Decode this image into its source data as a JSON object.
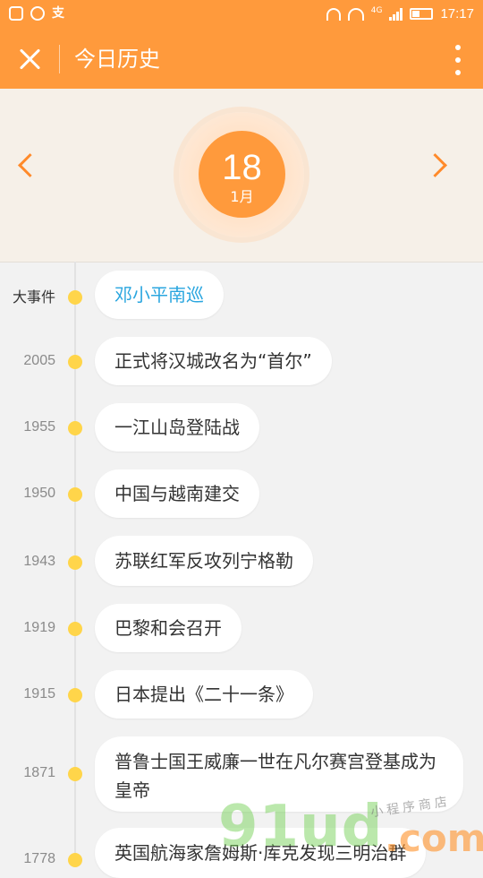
{
  "status_bar": {
    "time": "17:17",
    "network": "4G"
  },
  "app_bar": {
    "title": "今日历史"
  },
  "date": {
    "day": "18",
    "month": "1月"
  },
  "timeline": {
    "items": [
      {
        "year": "大事件",
        "event": "邓小平南巡"
      },
      {
        "year": "2005",
        "event": "正式将汉城改名为“首尔”"
      },
      {
        "year": "1955",
        "event": "一江山岛登陆战"
      },
      {
        "year": "1950",
        "event": "中国与越南建交"
      },
      {
        "year": "1943",
        "event": "苏联红军反攻列宁格勒"
      },
      {
        "year": "1919",
        "event": "巴黎和会召开"
      },
      {
        "year": "1915",
        "event": "日本提出《二十一条》"
      },
      {
        "year": "1871",
        "event": "普鲁士国王威廉一世在凡尔赛宫登基成为皇帝"
      },
      {
        "year": "1778",
        "event": "英国航海家詹姆斯·库克发现三明治群"
      }
    ]
  },
  "watermark": {
    "main": "91ud",
    "suffix": ".com",
    "tag": "小程序商店"
  },
  "colors": {
    "brand": "#ff9a3c",
    "dot": "#ffd54a",
    "highlight": "#2aa6df"
  }
}
